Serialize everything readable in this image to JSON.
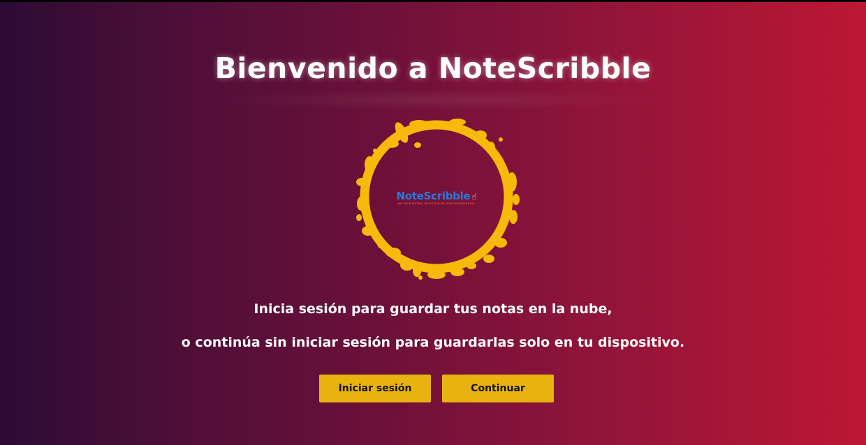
{
  "page": {
    "title": "Bienvenido a NoteScribble"
  },
  "logo": {
    "name": "NoteScribble",
    "tagline": "NO SOLO NOTAS, UN ESTILO DE VIDA ORGANIZADO.",
    "hand_icon": "hand-pointing-icon",
    "ring_color": "#f7b90a"
  },
  "message": {
    "line1": "Inicia sesión para guardar tus notas en la nube,",
    "line2": "o continúa sin iniciar sesión para guardarlas solo en tu dispositivo."
  },
  "buttons": {
    "login_label": "Iniciar sesión",
    "continue_label": "Continuar"
  },
  "colors": {
    "accent": "#e8b30e",
    "background_start": "#2c0b33",
    "background_end": "#bc1733"
  }
}
